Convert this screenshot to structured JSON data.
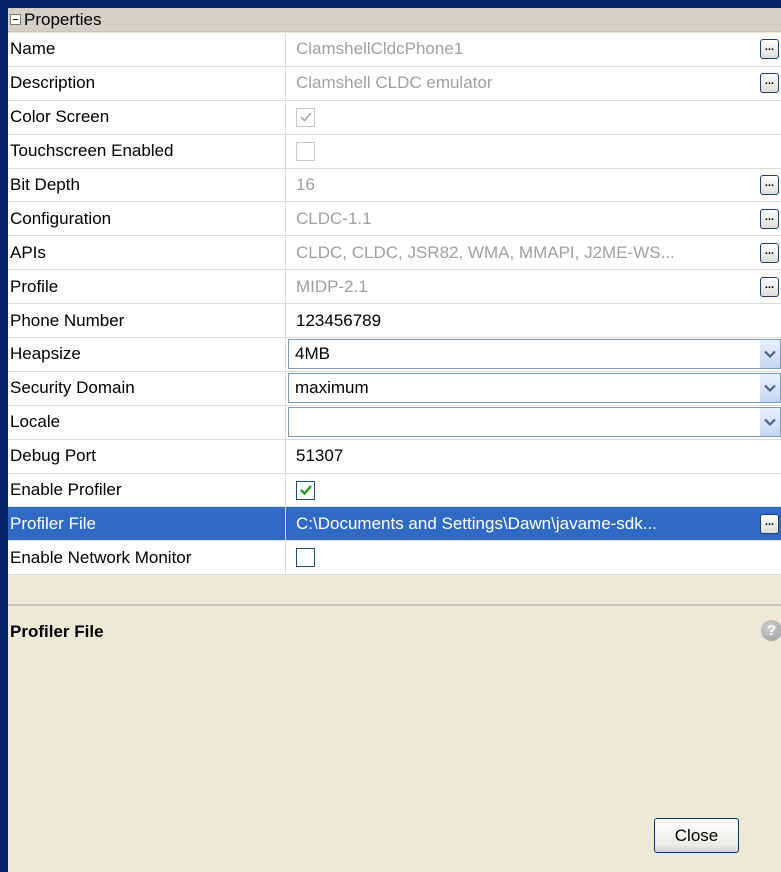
{
  "section": {
    "title": "Properties"
  },
  "rows": [
    {
      "name": "Name",
      "value": "ClamshellCldcPhone1"
    },
    {
      "name": "Description",
      "value": "Clamshell CLDC emulator"
    },
    {
      "name": "Color Screen",
      "checked": true
    },
    {
      "name": "Touchscreen Enabled",
      "checked": false
    },
    {
      "name": "Bit Depth",
      "value": "16"
    },
    {
      "name": "Configuration",
      "value": "CLDC-1.1"
    },
    {
      "name": "APIs",
      "value": "CLDC, CLDC, JSR82, WMA, MMAPI, J2ME-WS..."
    },
    {
      "name": "Profile",
      "value": "MIDP-2.1"
    },
    {
      "name": "Phone Number",
      "value": "123456789"
    },
    {
      "name": "Heapsize",
      "value": "4MB"
    },
    {
      "name": "Security Domain",
      "value": "maximum"
    },
    {
      "name": "Locale",
      "value": ""
    },
    {
      "name": "Debug Port",
      "value": "51307"
    },
    {
      "name": "Enable Profiler",
      "checked": true
    },
    {
      "name": "Profiler File",
      "value": "C:\\Documents and Settings\\Dawn\\javame-sdk..."
    },
    {
      "name": "Enable Network Monitor",
      "checked": false
    }
  ],
  "ellipsis_label": "...",
  "description": {
    "title": "Profiler File",
    "help_glyph": "?"
  },
  "buttons": {
    "close": "Close"
  },
  "colors": {
    "selection": "#316ac5",
    "readonly_text": "#a0a0a0",
    "check_enabled": "#21a121"
  }
}
